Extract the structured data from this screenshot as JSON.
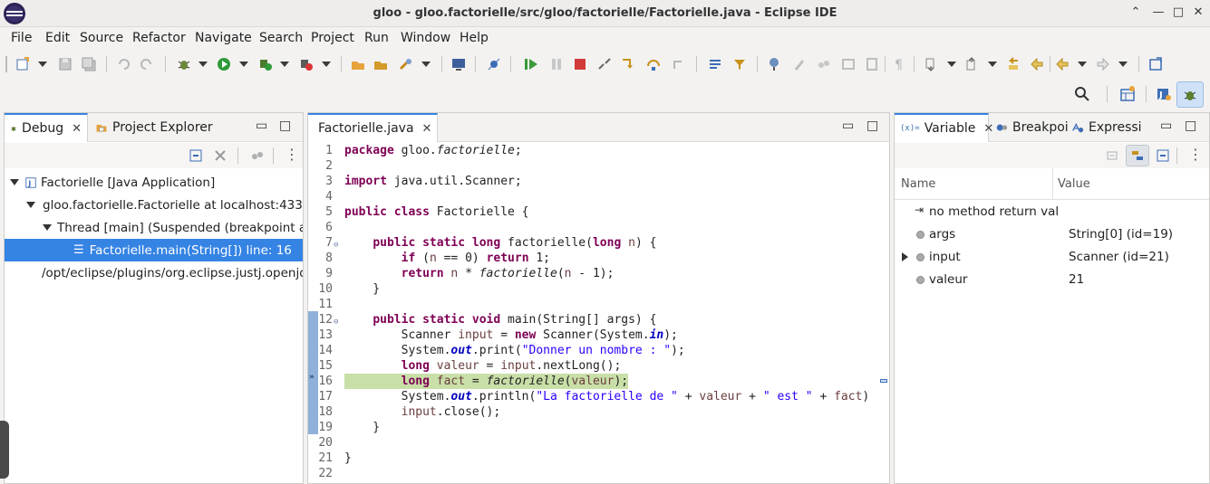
{
  "window": {
    "title": "gloo - gloo.factorielle/src/gloo/factorielle/Factorielle.java - Eclipse IDE",
    "controls": {
      "minimize": "⌃",
      "min2": "—",
      "maximize": "□",
      "close": "✕"
    }
  },
  "menubar": {
    "items": [
      "File",
      "Edit",
      "Source",
      "Refactor",
      "Navigate",
      "Search",
      "Project",
      "Run",
      "Window",
      "Help"
    ]
  },
  "debug_panel": {
    "tabs": [
      {
        "label": "Debug",
        "icon": "bug-icon",
        "active": true
      },
      {
        "label": "Project Explorer",
        "icon": "folder-icon",
        "active": false
      }
    ],
    "tree": [
      {
        "label": "Factorielle [Java Application]",
        "icon": "java-application-icon",
        "indent": 0,
        "expanded": true
      },
      {
        "label": "gloo.factorielle.Factorielle at localhost:43353",
        "icon": "debug-target-icon",
        "indent": 1,
        "expanded": true
      },
      {
        "label": "Thread [main] (Suspended (breakpoint at l",
        "icon": "thread-suspended-icon",
        "indent": 2,
        "expanded": true
      },
      {
        "label": "Factorielle.main(String[]) line: 16",
        "icon": "stack-frame-icon",
        "indent": 3,
        "selected": true
      },
      {
        "label": "/opt/eclipse/plugins/org.eclipse.justj.openjdk",
        "icon": "jre-process-icon",
        "indent": 1
      }
    ]
  },
  "editor": {
    "tab_label": "Factorielle.java",
    "current_line": 16,
    "lines": [
      {
        "n": "1",
        "code": "package gloo.factorielle;"
      },
      {
        "n": "2",
        "code": ""
      },
      {
        "n": "3",
        "code": "import java.util.Scanner;"
      },
      {
        "n": "4",
        "code": ""
      },
      {
        "n": "5",
        "code": "public class Factorielle {"
      },
      {
        "n": "6",
        "code": ""
      },
      {
        "n": "7",
        "code": "    public static long factorielle(long n) {"
      },
      {
        "n": "8",
        "code": "        if (n == 0) return 1;"
      },
      {
        "n": "9",
        "code": "        return n * factorielle(n - 1);"
      },
      {
        "n": "10",
        "code": "    }"
      },
      {
        "n": "11",
        "code": ""
      },
      {
        "n": "12",
        "code": "    public static void main(String[] args) {"
      },
      {
        "n": "13",
        "code": "        Scanner input = new Scanner(System.in);"
      },
      {
        "n": "14",
        "code": "        System.out.print(\"Donner un nombre : \");"
      },
      {
        "n": "15",
        "code": "        long valeur = input.nextLong();"
      },
      {
        "n": "16",
        "code": "        long fact = factorielle(valeur);"
      },
      {
        "n": "17",
        "code": "        System.out.println(\"La factorielle de \" + valeur + \" est \" + fact)"
      },
      {
        "n": "18",
        "code": "        input.close();"
      },
      {
        "n": "19",
        "code": "    }"
      },
      {
        "n": "20",
        "code": ""
      },
      {
        "n": "21",
        "code": "}"
      },
      {
        "n": "22",
        "code": ""
      }
    ]
  },
  "variables_panel": {
    "tabs": [
      {
        "label": "Variable",
        "icon": "variables-icon",
        "active": true
      },
      {
        "label": "Breakpoi",
        "icon": "breakpoints-icon",
        "active": false
      },
      {
        "label": "Expressi",
        "icon": "expressions-icon",
        "active": false
      }
    ],
    "columns": {
      "name": "Name",
      "value": "Value"
    },
    "rows": [
      {
        "name": "no method return val",
        "value": "",
        "icon": "method-return-icon"
      },
      {
        "name": "args",
        "value": "String[0]  (id=19)",
        "icon": "local-variable-icon"
      },
      {
        "name": "input",
        "value": "Scanner  (id=21)",
        "icon": "local-variable-icon",
        "expandable": true
      },
      {
        "name": "valeur",
        "value": "21",
        "icon": "local-variable-icon"
      }
    ]
  }
}
